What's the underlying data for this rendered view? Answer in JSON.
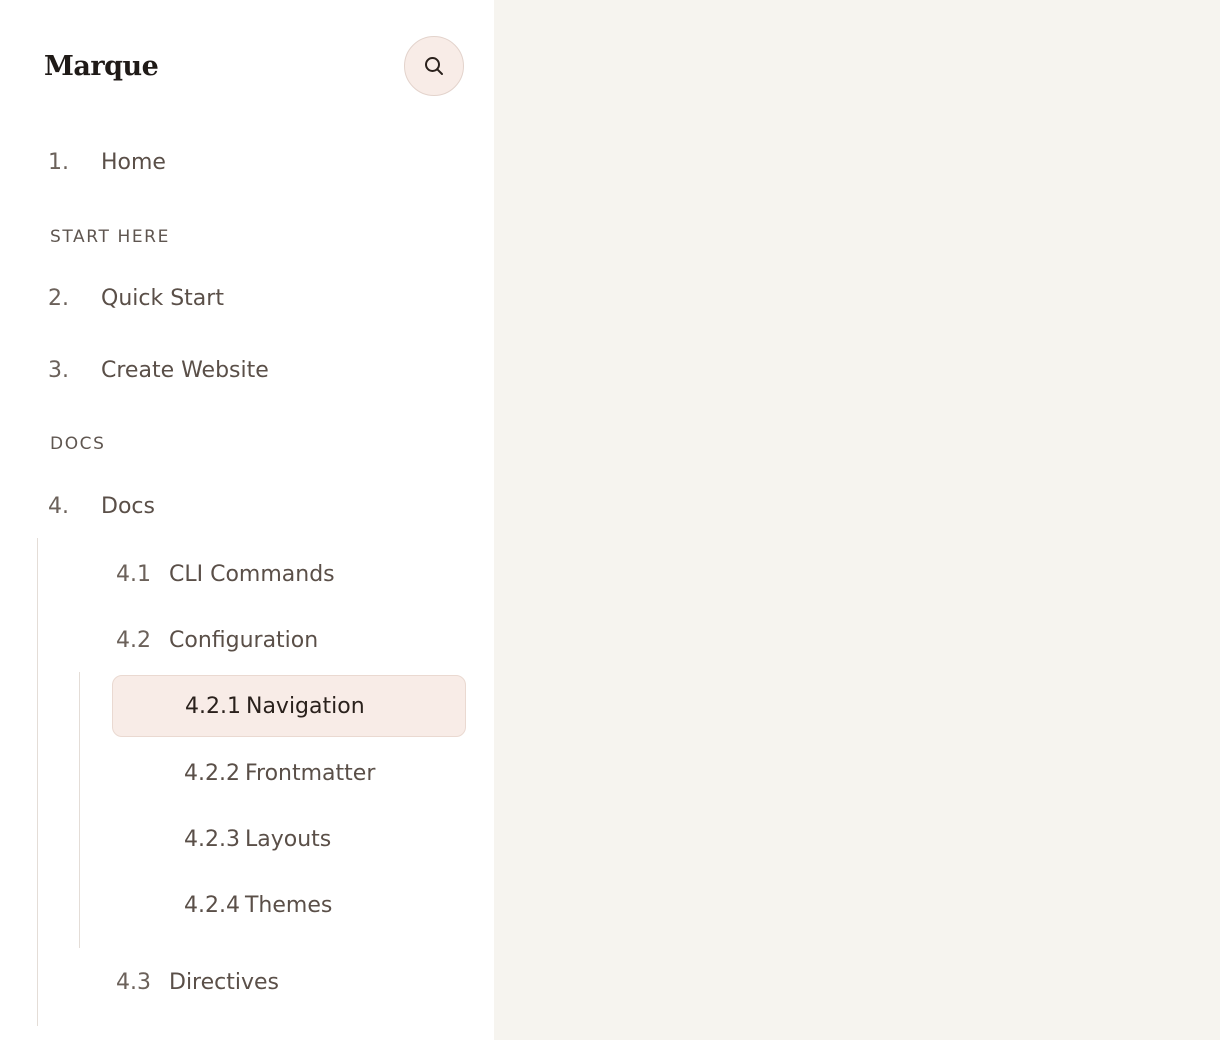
{
  "brand": {
    "title": "Marque"
  },
  "search": {
    "icon": "search-icon"
  },
  "nav": {
    "home": {
      "num": "1.",
      "label": "Home"
    },
    "section_start": "START HERE",
    "quick_start": {
      "num": "2.",
      "label": "Quick Start"
    },
    "create_website": {
      "num": "3.",
      "label": "Create Website"
    },
    "section_docs": "DOCS",
    "docs": {
      "num": "4.",
      "label": "Docs"
    },
    "cli_commands": {
      "num": "4.1",
      "label": "CLI Commands"
    },
    "configuration": {
      "num": "4.2",
      "label": "Configuration"
    },
    "navigation": {
      "num": "4.2.1",
      "label": "Navigation",
      "active": true
    },
    "frontmatter": {
      "num": "4.2.2",
      "label": "Frontmatter"
    },
    "layouts": {
      "num": "4.2.3",
      "label": "Layouts"
    },
    "themes": {
      "num": "4.2.4",
      "label": "Themes"
    },
    "directives": {
      "num": "4.3",
      "label": "Directives"
    }
  },
  "colors": {
    "sidebar_bg": "#ffffff",
    "main_bg": "#f6f4ef",
    "active_bg": "#f8ece7",
    "text": "#5a4f48"
  }
}
